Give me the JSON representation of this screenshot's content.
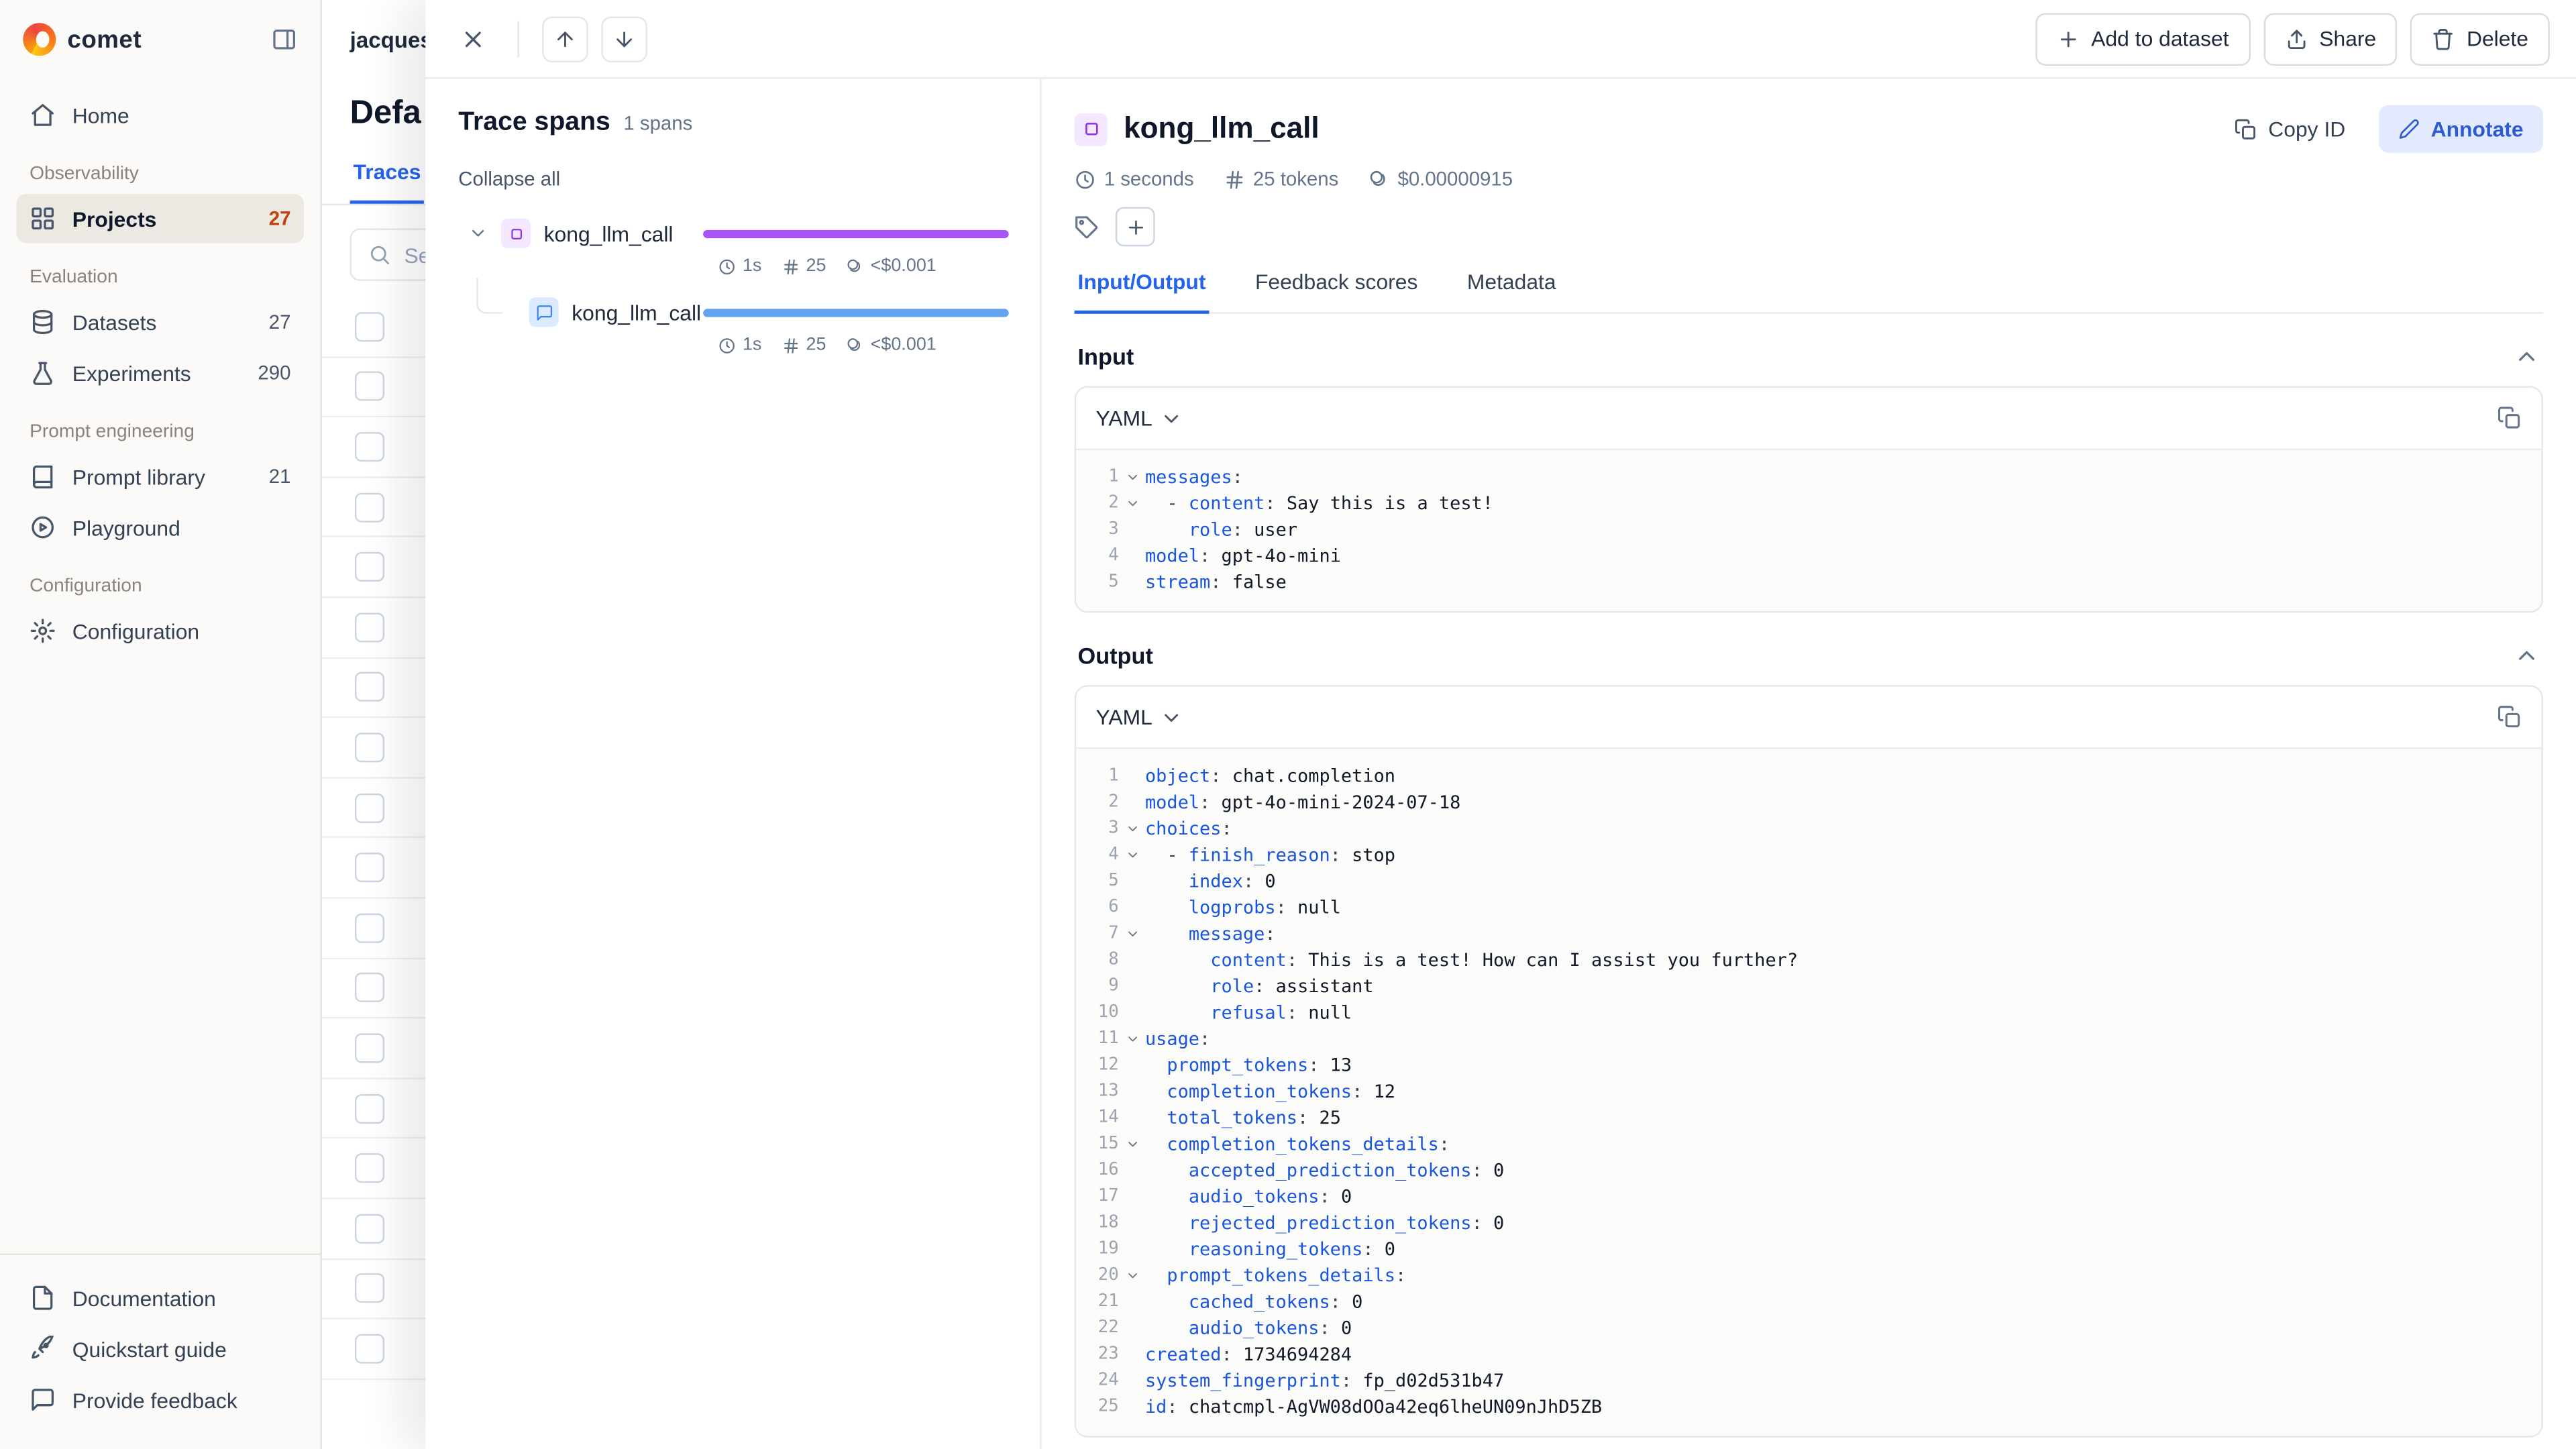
{
  "colors": {
    "accent": "#2563EB",
    "span_purple": "#A855F7",
    "span_blue": "#64A3EE"
  },
  "sidebar": {
    "brand": "comet",
    "items": [
      {
        "type": "item",
        "label": "Home",
        "icon": "home"
      },
      {
        "type": "section",
        "label": "Observability"
      },
      {
        "type": "item",
        "label": "Projects",
        "icon": "grid",
        "count": "27",
        "active": true
      },
      {
        "type": "section",
        "label": "Evaluation"
      },
      {
        "type": "item",
        "label": "Datasets",
        "icon": "database",
        "count": "27"
      },
      {
        "type": "item",
        "label": "Experiments",
        "icon": "flask",
        "count": "290"
      },
      {
        "type": "section",
        "label": "Prompt engineering"
      },
      {
        "type": "item",
        "label": "Prompt library",
        "icon": "book",
        "count": "21"
      },
      {
        "type": "item",
        "label": "Playground",
        "icon": "play"
      },
      {
        "type": "section",
        "label": "Configuration"
      },
      {
        "type": "item",
        "label": "Configuration",
        "icon": "gear"
      }
    ],
    "footer": [
      {
        "label": "Documentation",
        "icon": "doc"
      },
      {
        "label": "Quickstart guide",
        "icon": "rocket"
      },
      {
        "label": "Provide feedback",
        "icon": "chat"
      }
    ]
  },
  "header": {
    "username": "jacques"
  },
  "background_page": {
    "title": "Defa",
    "active_tab": "Traces",
    "search_text": "Se"
  },
  "overlay": {
    "toolbar": {
      "add_to_dataset": "Add to dataset",
      "share": "Share",
      "delete": "Delete"
    },
    "spans_panel": {
      "title": "Trace spans",
      "count": "1 spans",
      "collapse_all": "Collapse all",
      "rows": [
        {
          "label": "kong_llm_call",
          "type": "llm",
          "color": "#A855F7",
          "duration": "1s",
          "tokens": "25",
          "cost": "<$0.001",
          "child": false
        },
        {
          "label": "kong_llm_call",
          "type": "chat",
          "color": "#64A3EE",
          "duration": "1s",
          "tokens": "25",
          "cost": "<$0.001",
          "child": true
        }
      ]
    },
    "detail": {
      "title": "kong_llm_call",
      "copy_id": "Copy ID",
      "annotate": "Annotate",
      "duration": "1 seconds",
      "tokens": "25 tokens",
      "cost": "$0.00000915",
      "tabs": [
        {
          "label": "Input/Output",
          "active": true
        },
        {
          "label": "Feedback scores",
          "active": false
        },
        {
          "label": "Metadata",
          "active": false
        }
      ],
      "input_section": {
        "title": "Input",
        "format": "YAML"
      },
      "output_section": {
        "title": "Output",
        "format": "YAML"
      },
      "input_lines": [
        {
          "n": 1,
          "ind": 0,
          "fold": true,
          "key": "messages",
          "value": ""
        },
        {
          "n": 2,
          "ind": 2,
          "dash": true,
          "fold": true,
          "key": "content",
          "value": "Say this is a test!"
        },
        {
          "n": 3,
          "ind": 4,
          "key": "role",
          "value": "user"
        },
        {
          "n": 4,
          "ind": 0,
          "key": "model",
          "value": "gpt-4o-mini"
        },
        {
          "n": 5,
          "ind": 0,
          "key": "stream",
          "value": "false"
        }
      ],
      "output_lines": [
        {
          "n": 1,
          "ind": 0,
          "key": "object",
          "value": "chat.completion"
        },
        {
          "n": 2,
          "ind": 0,
          "key": "model",
          "value": "gpt-4o-mini-2024-07-18"
        },
        {
          "n": 3,
          "ind": 0,
          "fold": true,
          "key": "choices",
          "value": ""
        },
        {
          "n": 4,
          "ind": 2,
          "dash": true,
          "fold": true,
          "key": "finish_reason",
          "value": "stop"
        },
        {
          "n": 5,
          "ind": 4,
          "key": "index",
          "value": "0"
        },
        {
          "n": 6,
          "ind": 4,
          "key": "logprobs",
          "value": "null"
        },
        {
          "n": 7,
          "ind": 4,
          "fold": true,
          "key": "message",
          "value": ""
        },
        {
          "n": 8,
          "ind": 6,
          "key": "content",
          "value": "This is a test! How can I assist you further?"
        },
        {
          "n": 9,
          "ind": 6,
          "key": "role",
          "value": "assistant"
        },
        {
          "n": 10,
          "ind": 6,
          "key": "refusal",
          "value": "null"
        },
        {
          "n": 11,
          "ind": 0,
          "fold": true,
          "key": "usage",
          "value": ""
        },
        {
          "n": 12,
          "ind": 2,
          "key": "prompt_tokens",
          "value": "13"
        },
        {
          "n": 13,
          "ind": 2,
          "key": "completion_tokens",
          "value": "12"
        },
        {
          "n": 14,
          "ind": 2,
          "key": "total_tokens",
          "value": "25"
        },
        {
          "n": 15,
          "ind": 2,
          "fold": true,
          "key": "completion_tokens_details",
          "value": ""
        },
        {
          "n": 16,
          "ind": 4,
          "key": "accepted_prediction_tokens",
          "value": "0"
        },
        {
          "n": 17,
          "ind": 4,
          "key": "audio_tokens",
          "value": "0"
        },
        {
          "n": 18,
          "ind": 4,
          "key": "rejected_prediction_tokens",
          "value": "0"
        },
        {
          "n": 19,
          "ind": 4,
          "key": "reasoning_tokens",
          "value": "0"
        },
        {
          "n": 20,
          "ind": 2,
          "fold": true,
          "key": "prompt_tokens_details",
          "value": ""
        },
        {
          "n": 21,
          "ind": 4,
          "key": "cached_tokens",
          "value": "0"
        },
        {
          "n": 22,
          "ind": 4,
          "key": "audio_tokens",
          "value": "0"
        },
        {
          "n": 23,
          "ind": 0,
          "key": "created",
          "value": "1734694284"
        },
        {
          "n": 24,
          "ind": 0,
          "key": "system_fingerprint",
          "value": "fp_d02d531b47"
        },
        {
          "n": 25,
          "ind": 0,
          "key": "id",
          "value": "chatcmpl-AgVW08dOOa42eq6lheUN09nJhD5ZB"
        }
      ]
    }
  }
}
